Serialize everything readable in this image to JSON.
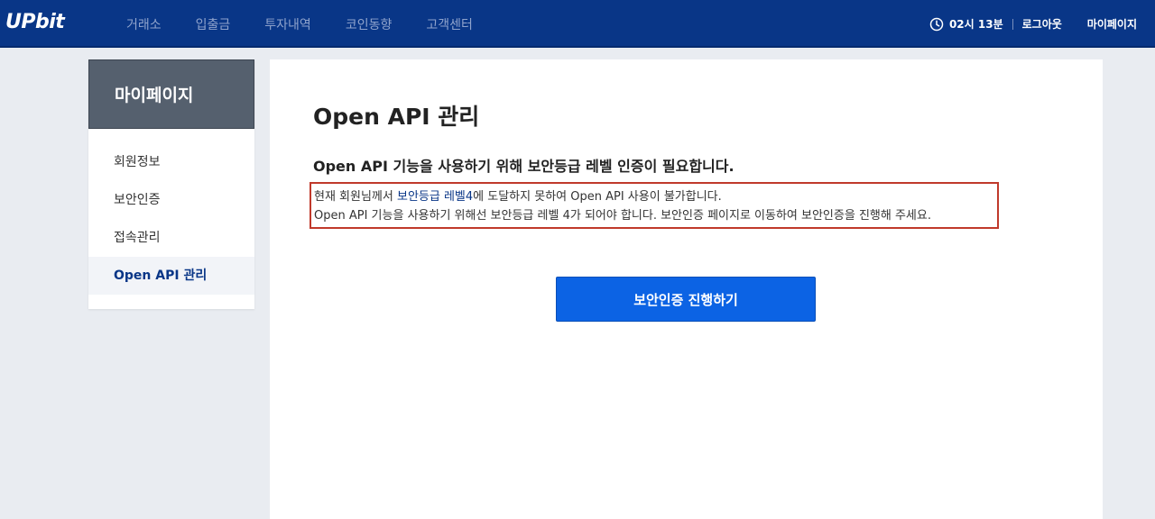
{
  "header": {
    "logo": "UPbit",
    "nav": [
      "거래소",
      "입출금",
      "투자내역",
      "코인동향",
      "고객센터"
    ],
    "session_time": "02시 13분",
    "logout": "로그아웃",
    "mypage": "마이페이지",
    "clock_icon": "clock-icon",
    "colors": {
      "bar": "#093687",
      "nav_text": "#8fa3cc"
    }
  },
  "sidebar": {
    "title": "마이페이지",
    "items": [
      {
        "label": "회원정보",
        "active": false
      },
      {
        "label": "보안인증",
        "active": false
      },
      {
        "label": "접속관리",
        "active": false
      },
      {
        "label": "Open API 관리",
        "active": true
      }
    ]
  },
  "main": {
    "title": "Open API 관리",
    "subtitle": "Open API 기능을 사용하기 위해 보안등급 레벨 인증이 필요합니다.",
    "notice": {
      "line1_pre": "현재 회원님께서 ",
      "line1_link": "보안등급 레벨4",
      "line1_post": "에 도달하지 못하여 Open API 사용이 불가합니다.",
      "line2": "Open API 기능을 사용하기 위해선 보안등급 레벨 4가 되어야 합니다. 보안인증 페이지로 이동하여 보안인증을 진행해 주세요."
    },
    "button": "보안인증 진행하기",
    "colors": {
      "button": "#0c63e4",
      "notice_border": "#c0392b"
    }
  }
}
